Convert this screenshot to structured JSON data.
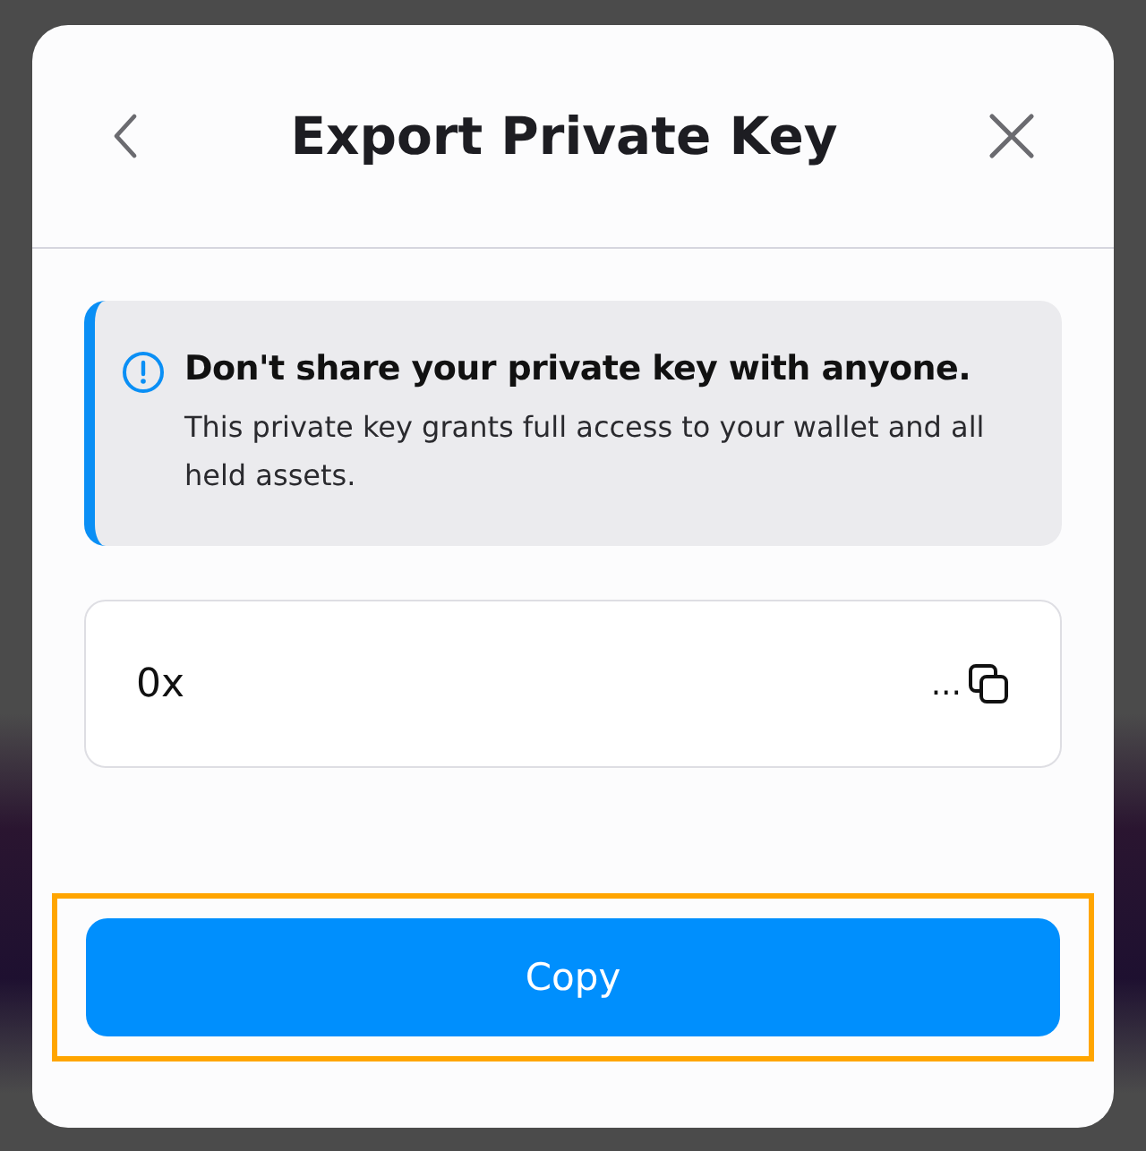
{
  "dialog": {
    "title": "Export Private Key"
  },
  "alert": {
    "title": "Don't share your private key with anyone.",
    "message": "This private key grants full access to your wallet and all held assets."
  },
  "key_field": {
    "value": "0x",
    "ellipsis": "..."
  },
  "copy_button": {
    "label": "Copy",
    "highlighted": true
  }
}
